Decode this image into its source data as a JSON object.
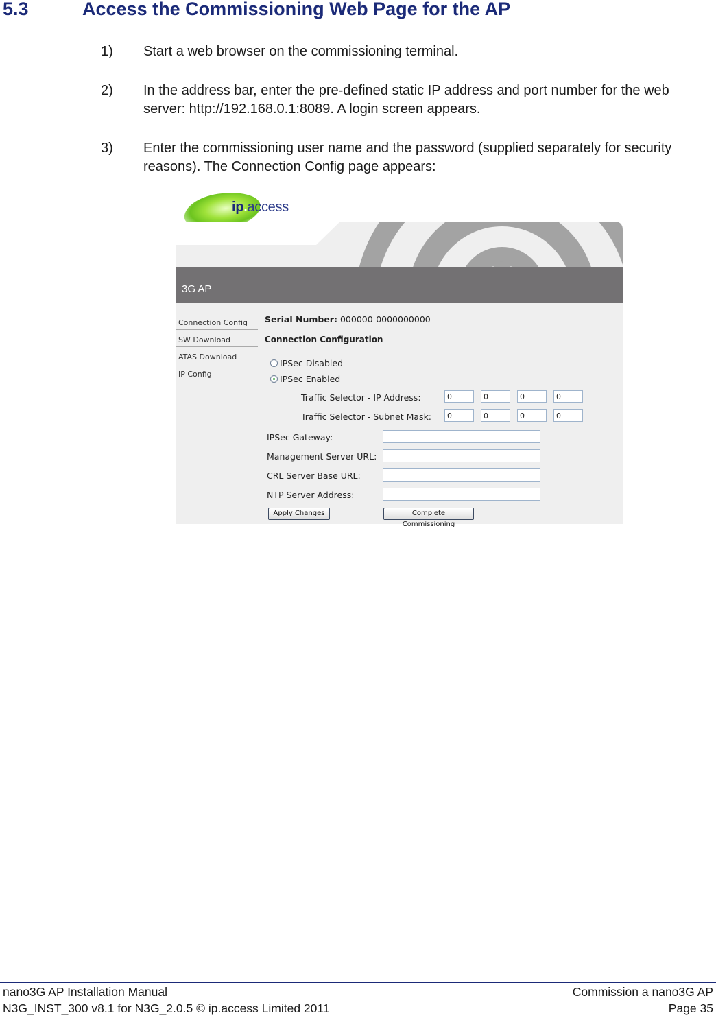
{
  "heading": {
    "number": "5.3",
    "title": "Access the Commissioning Web Page for the AP"
  },
  "steps": [
    {
      "num": "1)",
      "text": "Start a web browser on the commissioning terminal."
    },
    {
      "num": "2)",
      "text": "In the address bar, enter the pre-defined static IP address and port number for the web server: http://192.168.0.1:8089. A login screen appears."
    },
    {
      "num": "3)",
      "text": "Enter the commissioning user name and the password (supplied separately for security reasons). The Connection Config page appears:"
    }
  ],
  "screenshot": {
    "logo": {
      "ip": "ip",
      "dot": ".",
      "access": "access"
    },
    "app_title": "3G AP",
    "nav": [
      {
        "label": "Connection Config"
      },
      {
        "label": "SW Download"
      },
      {
        "label": "ATAS Download"
      },
      {
        "label": "IP Config"
      }
    ],
    "serial": {
      "label": "Serial Number:",
      "value": "000000-0000000000"
    },
    "section_title": "Connection Configuration",
    "ipsec_options": [
      {
        "label": "IPSec Disabled",
        "selected": false
      },
      {
        "label": "IPSec Enabled",
        "selected": true
      }
    ],
    "traffic_selector": {
      "ip_label": "Traffic Selector - IP Address:",
      "ip_values": [
        "0",
        "0",
        "0",
        "0"
      ],
      "mask_label": "Traffic Selector - Subnet Mask:",
      "mask_values": [
        "0",
        "0",
        "0",
        "0"
      ]
    },
    "fields": [
      {
        "label": "IPSec Gateway:",
        "value": ""
      },
      {
        "label": "Management Server URL:",
        "value": ""
      },
      {
        "label": "CRL Server Base URL:",
        "value": ""
      },
      {
        "label": "NTP Server Address:",
        "value": ""
      }
    ],
    "buttons": {
      "apply": "Apply Changes",
      "complete": "Complete Commissioning"
    }
  },
  "footer": {
    "left_line1": "nano3G AP Installation Manual",
    "left_line2": "N3G_INST_300 v8.1 for N3G_2.0.5 © ip.access Limited 2011",
    "right_line1": "Commission a nano3G AP",
    "right_line2": "Page 35"
  },
  "colors": {
    "heading": "#1b2a78",
    "titlebar": "#737173",
    "content_bg": "#efefef",
    "logo_green": "#6cc41f"
  }
}
